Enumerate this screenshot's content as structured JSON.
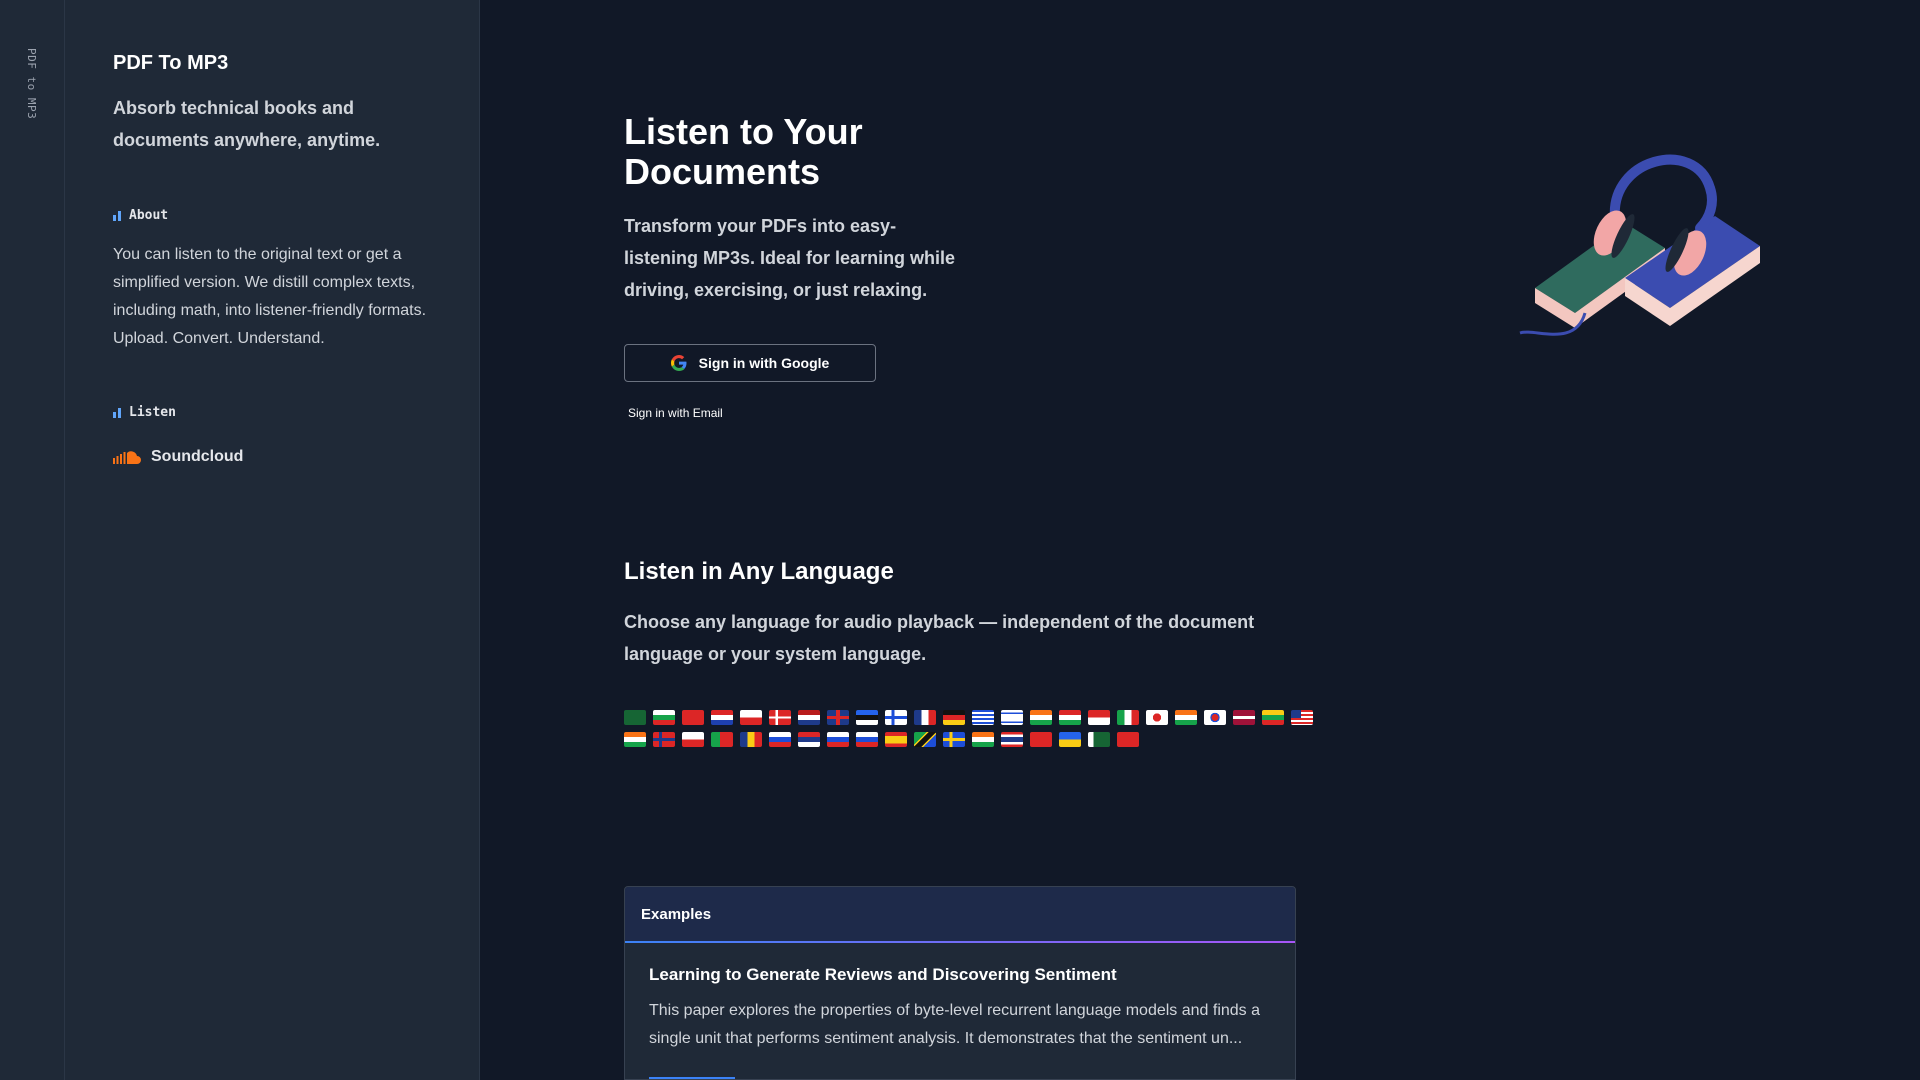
{
  "rail": {
    "label": "PDF to MP3"
  },
  "sidebar": {
    "title": "PDF To MP3",
    "tagline": "Absorb technical books and documents anywhere, anytime.",
    "about_label": "About",
    "about_text": "You can listen to the original text or get a simplified version. We distill complex texts, including math, into listener-friendly formats. Upload. Convert. Understand.",
    "listen_label": "Listen",
    "soundcloud_label": "Soundcloud"
  },
  "hero": {
    "title": "Listen to Your Documents",
    "subtitle": "Transform your PDFs into easy-listening MP3s. Ideal for learning while driving, exercising, or just relaxing.",
    "google_button": "Sign in with Google",
    "email_link": "Sign in with Email"
  },
  "languages": {
    "title": "Listen in Any Language",
    "subtitle": "Choose any language for audio playback — independent of the document language or your system language.",
    "flags": [
      "saudi-arabia",
      "bulgaria",
      "china",
      "croatia",
      "czechia",
      "denmark",
      "netherlands",
      "united-kingdom",
      "estonia",
      "finland",
      "france",
      "germany",
      "greece",
      "israel",
      "india",
      "hungary",
      "indonesia",
      "italy",
      "japan",
      "india-2",
      "south-korea",
      "latvia",
      "lithuania",
      "malaysia",
      "india-3",
      "norway",
      "poland",
      "portugal",
      "romania",
      "russia",
      "serbia",
      "slovakia",
      "slovenia",
      "spain",
      "tanzania",
      "sweden",
      "india-4",
      "thailand",
      "turkey",
      "ukraine",
      "pakistan",
      "vietnam"
    ]
  },
  "examples": {
    "header": "Examples",
    "item_title": "Learning to Generate Reviews and Discovering Sentiment",
    "item_desc": "This paper explores the properties of byte-level recurrent language models and finds a single unit that performs sentiment analysis. It demonstrates that the sentiment un..."
  },
  "colors": {
    "background": "#111827",
    "sidebar": "#1f2937",
    "accent": "#3b82f6",
    "soundcloud": "#f97316"
  }
}
